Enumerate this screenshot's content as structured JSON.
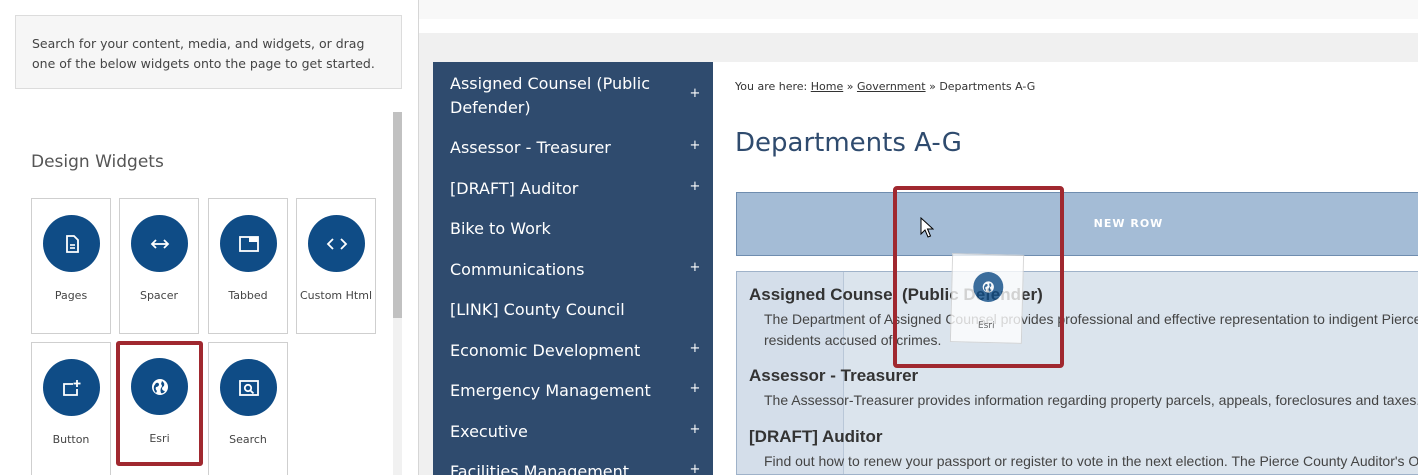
{
  "panel": {
    "info_text": "Search for your content, media, and widgets, or drag one of the below widgets onto the page to get started.",
    "section_title": "Design Widgets",
    "widgets": [
      {
        "label": "Pages",
        "icon": "page-icon"
      },
      {
        "label": "Spacer",
        "icon": "arrows-horizontal-icon"
      },
      {
        "label": "Tabbed",
        "icon": "tabbed-window-icon"
      },
      {
        "label": "Custom Html",
        "icon": "code-icon"
      },
      {
        "label": "Button",
        "icon": "add-button-icon"
      },
      {
        "label": "Esri",
        "icon": "globe-icon"
      },
      {
        "label": "Search",
        "icon": "search-image-icon"
      }
    ]
  },
  "nav": {
    "items": [
      {
        "label": "Assigned Counsel (Public Defender)",
        "expandable": true
      },
      {
        "label": "Assessor - Treasurer",
        "expandable": true
      },
      {
        "label": "[DRAFT] Auditor",
        "expandable": true
      },
      {
        "label": "Bike to Work",
        "expandable": false
      },
      {
        "label": "Communications",
        "expandable": true
      },
      {
        "label": "[LINK] County Council",
        "expandable": false
      },
      {
        "label": "Economic Development",
        "expandable": true
      },
      {
        "label": "Emergency Management",
        "expandable": true
      },
      {
        "label": "Executive",
        "expandable": true
      },
      {
        "label": "Facilities Management",
        "expandable": true
      }
    ],
    "expand_symbol": "+"
  },
  "breadcrumb": {
    "prefix": "You are here:",
    "home": "Home",
    "government": "Government",
    "current": "Departments A-G",
    "separator": "»"
  },
  "page": {
    "title": "Departments A-G",
    "new_row_label": "NEW ROW"
  },
  "departments": [
    {
      "title": "Assigned Counsel (Public Defender)",
      "desc_lines": [
        "The Department of Assigned Counsel provides professional and effective representation to indigent Pierce County",
        "residents accused of crimes."
      ]
    },
    {
      "title": "Assessor - Treasurer",
      "desc_lines": [
        "The Assessor-Treasurer provides information regarding property parcels, appeals, foreclosures and taxes."
      ]
    },
    {
      "title": "[DRAFT] Auditor",
      "desc_lines": [
        "Find out how to renew your passport or register to vote in the next election. The Pierce County Auditor's Office"
      ]
    }
  ],
  "drag": {
    "label": "Esri",
    "icon": "globe-icon"
  },
  "colors": {
    "brand_blue": "#0f4c86",
    "nav_bg": "#2f4b6e",
    "highlight_red": "#a0282f",
    "new_row_bg": "#a4bcd6"
  }
}
